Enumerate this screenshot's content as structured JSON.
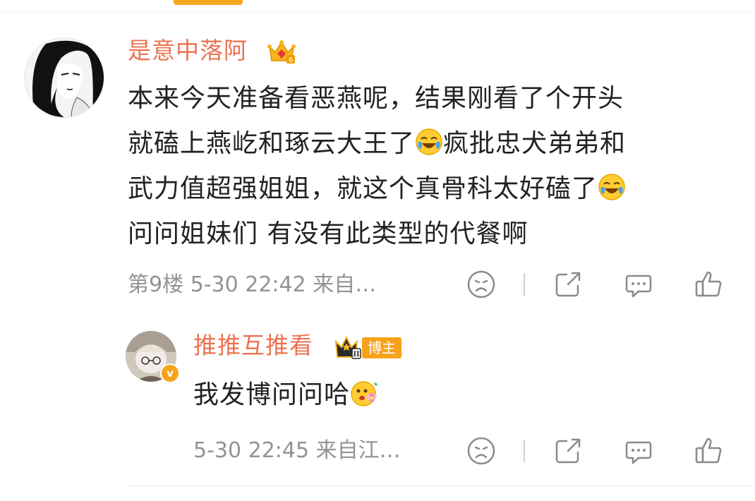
{
  "comment": {
    "username": "是意中落阿",
    "lines": [
      "本来今天准备看恶燕呢，结果刚看了个开头",
      "就磕上燕屹和琢云大王了",
      "疯批忠犬弟弟和",
      "武力值超强姐姐，就这个真骨科太好磕了",
      "问问姐妹们 有没有此类型的代餐啊"
    ],
    "meta": "第9楼 5-30 22:42 来自…",
    "badge_level": "6",
    "icons": [
      "dislike-icon",
      "share-icon",
      "reply-icon",
      "like-icon"
    ]
  },
  "reply": {
    "username": "推推互推看",
    "crown_level": "II",
    "tag": "博主",
    "text": "我发博问问哈",
    "meta": "5-30 22:45 来自江…",
    "verified_mark": "v",
    "icons": [
      "dislike-icon",
      "share-icon",
      "reply-icon",
      "like-icon"
    ]
  },
  "colors": {
    "username": "#eb7350",
    "meta": "#939393",
    "accent": "#f7a21b",
    "text": "#222222"
  }
}
